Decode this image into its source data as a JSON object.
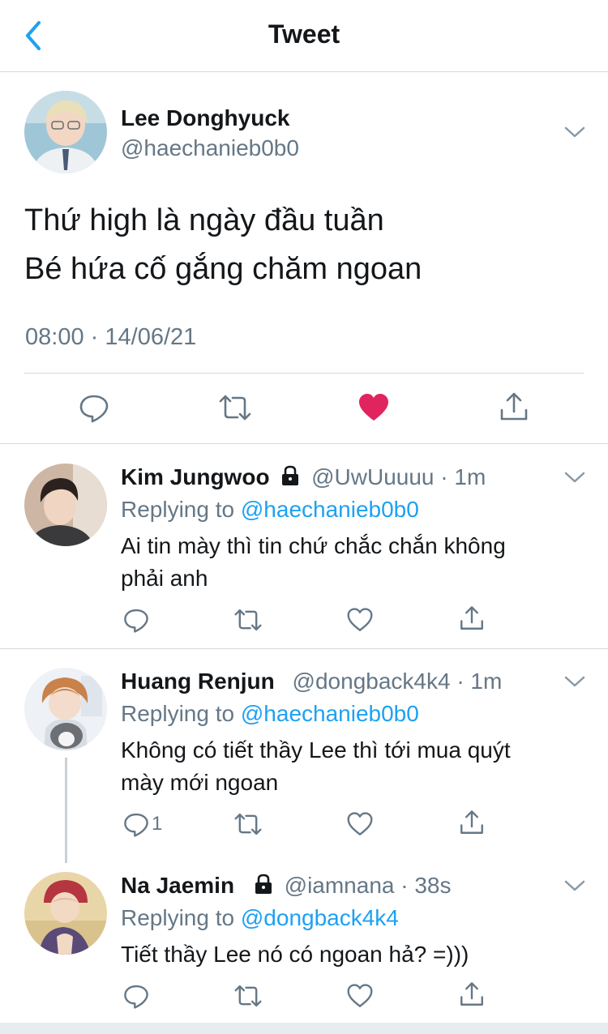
{
  "header": {
    "title": "Tweet"
  },
  "main_tweet": {
    "author_name": "Lee Donghyuck",
    "author_handle": "@haechanieb0b0",
    "text_lines": [
      "Thứ high là ngày đầu tuần",
      "Bé hứa cố gắng chăm ngoan"
    ],
    "time": "08:00",
    "separator": "·",
    "date": "14/06/21",
    "liked": true,
    "colors": {
      "like_active": "#e0245e",
      "icon": "#657786"
    }
  },
  "replies": [
    {
      "author_name": "Kim Jungwoo",
      "locked": true,
      "handle_time": "@UwUuuuu · 1m",
      "replying_label": "Replying to",
      "replying_to": "@haechanieb0b0",
      "text_lines": [
        "Ai tin mày thì tin chứ chắc chắn không",
        "phải anh"
      ],
      "reply_count": ""
    },
    {
      "author_name": "Huang Renjun",
      "locked": false,
      "handle_time": "@dongback4k4 · 1m",
      "replying_label": "Replying to",
      "replying_to": "@haechanieb0b0",
      "text_lines": [
        "Không có tiết thầy Lee thì tới mua quýt",
        "mày mới ngoan"
      ],
      "reply_count": "1"
    },
    {
      "author_name": "Na Jaemin",
      "locked": true,
      "handle_time": "@iamnana · 38s",
      "replying_label": "Replying to",
      "replying_to": "@dongback4k4",
      "text_lines": [
        "Tiết thầy Lee nó có ngoan hả? =)))"
      ],
      "reply_count": ""
    }
  ],
  "theme": {
    "link": "#1da1f2",
    "secondary_text": "#657786",
    "divider": "#d6d9dc"
  }
}
